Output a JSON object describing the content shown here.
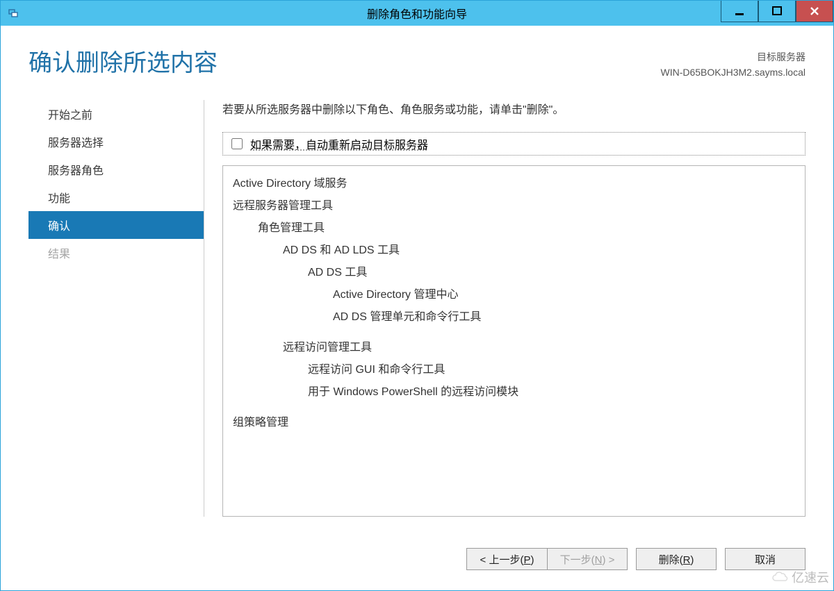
{
  "window": {
    "title": "删除角色和功能向导"
  },
  "header": {
    "heading": "确认删除所选内容",
    "target_label": "目标服务器",
    "target_server": "WIN-D65BOKJH3M2.sayms.local"
  },
  "sidebar": {
    "items": [
      {
        "label": "开始之前",
        "state": "normal"
      },
      {
        "label": "服务器选择",
        "state": "normal"
      },
      {
        "label": "服务器角色",
        "state": "normal"
      },
      {
        "label": "功能",
        "state": "normal"
      },
      {
        "label": "确认",
        "state": "selected"
      },
      {
        "label": "结果",
        "state": "disabled"
      }
    ]
  },
  "content": {
    "instruction": "若要从所选服务器中删除以下角色、角色服务或功能，请单击\"删除\"。",
    "restart_checkbox": {
      "checked": false,
      "label": "如果需要，自动重新启动目标服务器"
    },
    "items": [
      {
        "indent": 0,
        "text": "Active Directory 域服务"
      },
      {
        "indent": 0,
        "text": "远程服务器管理工具"
      },
      {
        "indent": 1,
        "text": "角色管理工具"
      },
      {
        "indent": 2,
        "text": "AD DS 和 AD LDS 工具"
      },
      {
        "indent": 3,
        "text": "AD DS 工具"
      },
      {
        "indent": 4,
        "text": "Active Directory 管理中心"
      },
      {
        "indent": 4,
        "text": "AD DS 管理单元和命令行工具"
      },
      {
        "indent": 2,
        "text": "远程访问管理工具",
        "gap": true
      },
      {
        "indent": 3,
        "text": "远程访问 GUI 和命令行工具"
      },
      {
        "indent": 3,
        "text": "用于 Windows PowerShell 的远程访问模块"
      },
      {
        "indent": 0,
        "text": "组策略管理",
        "gap": true
      }
    ]
  },
  "footer": {
    "prev": {
      "label": "< 上一步(",
      "mn": "P",
      "tail": ")"
    },
    "next": {
      "label": "下一步(",
      "mn": "N",
      "tail": ") >",
      "disabled": true
    },
    "remove": {
      "label": "删除(",
      "mn": "R",
      "tail": ")"
    },
    "cancel": {
      "label": "取消"
    }
  },
  "watermark": "亿速云"
}
